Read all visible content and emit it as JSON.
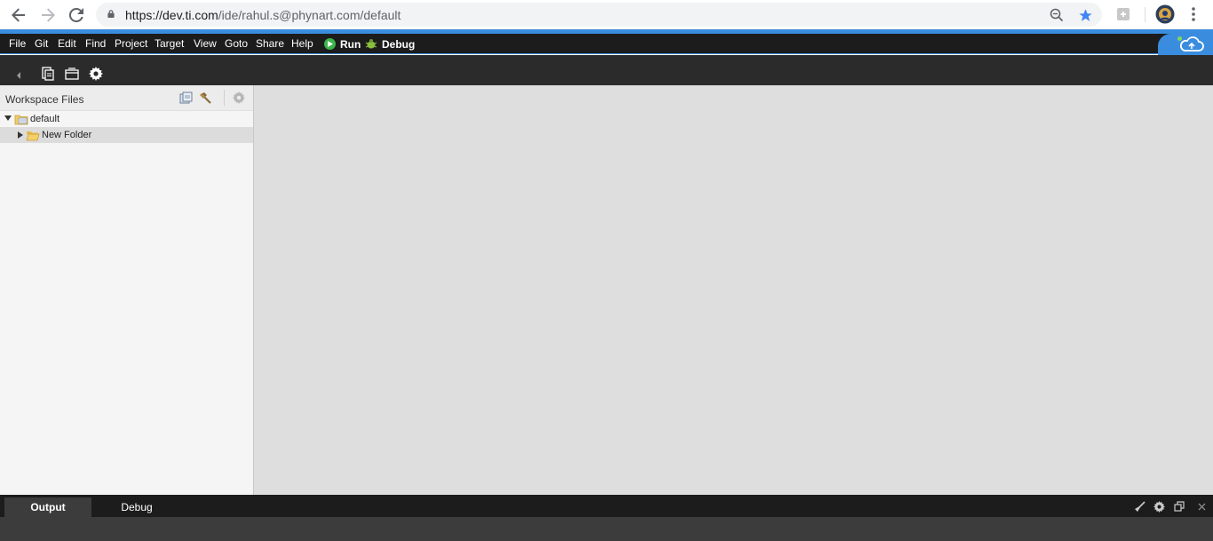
{
  "browser": {
    "url_host": "https://dev.ti.com",
    "url_path": "/ide/rahul.s@phynart.com/default",
    "icons": [
      "back-arrow-icon",
      "forward-arrow-icon",
      "reload-icon",
      "lock-icon",
      "zoom-icon",
      "star-icon",
      "extension-icon",
      "profile-avatar",
      "menu-kebab-icon"
    ],
    "accent_color": "#4285f4"
  },
  "menubar": {
    "items": [
      "File",
      "Git",
      "Edit",
      "Find",
      "Project",
      "Target",
      "View",
      "Goto",
      "Share",
      "Help"
    ],
    "run_label": "Run",
    "debug_label": "Debug",
    "accent_color": "#3a8dde"
  },
  "toolbar": {
    "icons": [
      "collapse-arrow-icon",
      "new-file-icon",
      "import-icon",
      "settings-gear-icon"
    ]
  },
  "sidebar": {
    "title": "Workspace Files",
    "tree": [
      {
        "label": "default",
        "expanded": true,
        "icon": "project-folder-icon"
      },
      {
        "label": "New Folder",
        "expanded": false,
        "icon": "open-folder-icon",
        "selected": true
      }
    ]
  },
  "bottom": {
    "tabs": [
      "Output",
      "Debug"
    ],
    "active_tab": "Output",
    "icons": [
      "clear-broom-icon",
      "gear-icon",
      "restore-window-icon",
      "close-icon"
    ]
  }
}
